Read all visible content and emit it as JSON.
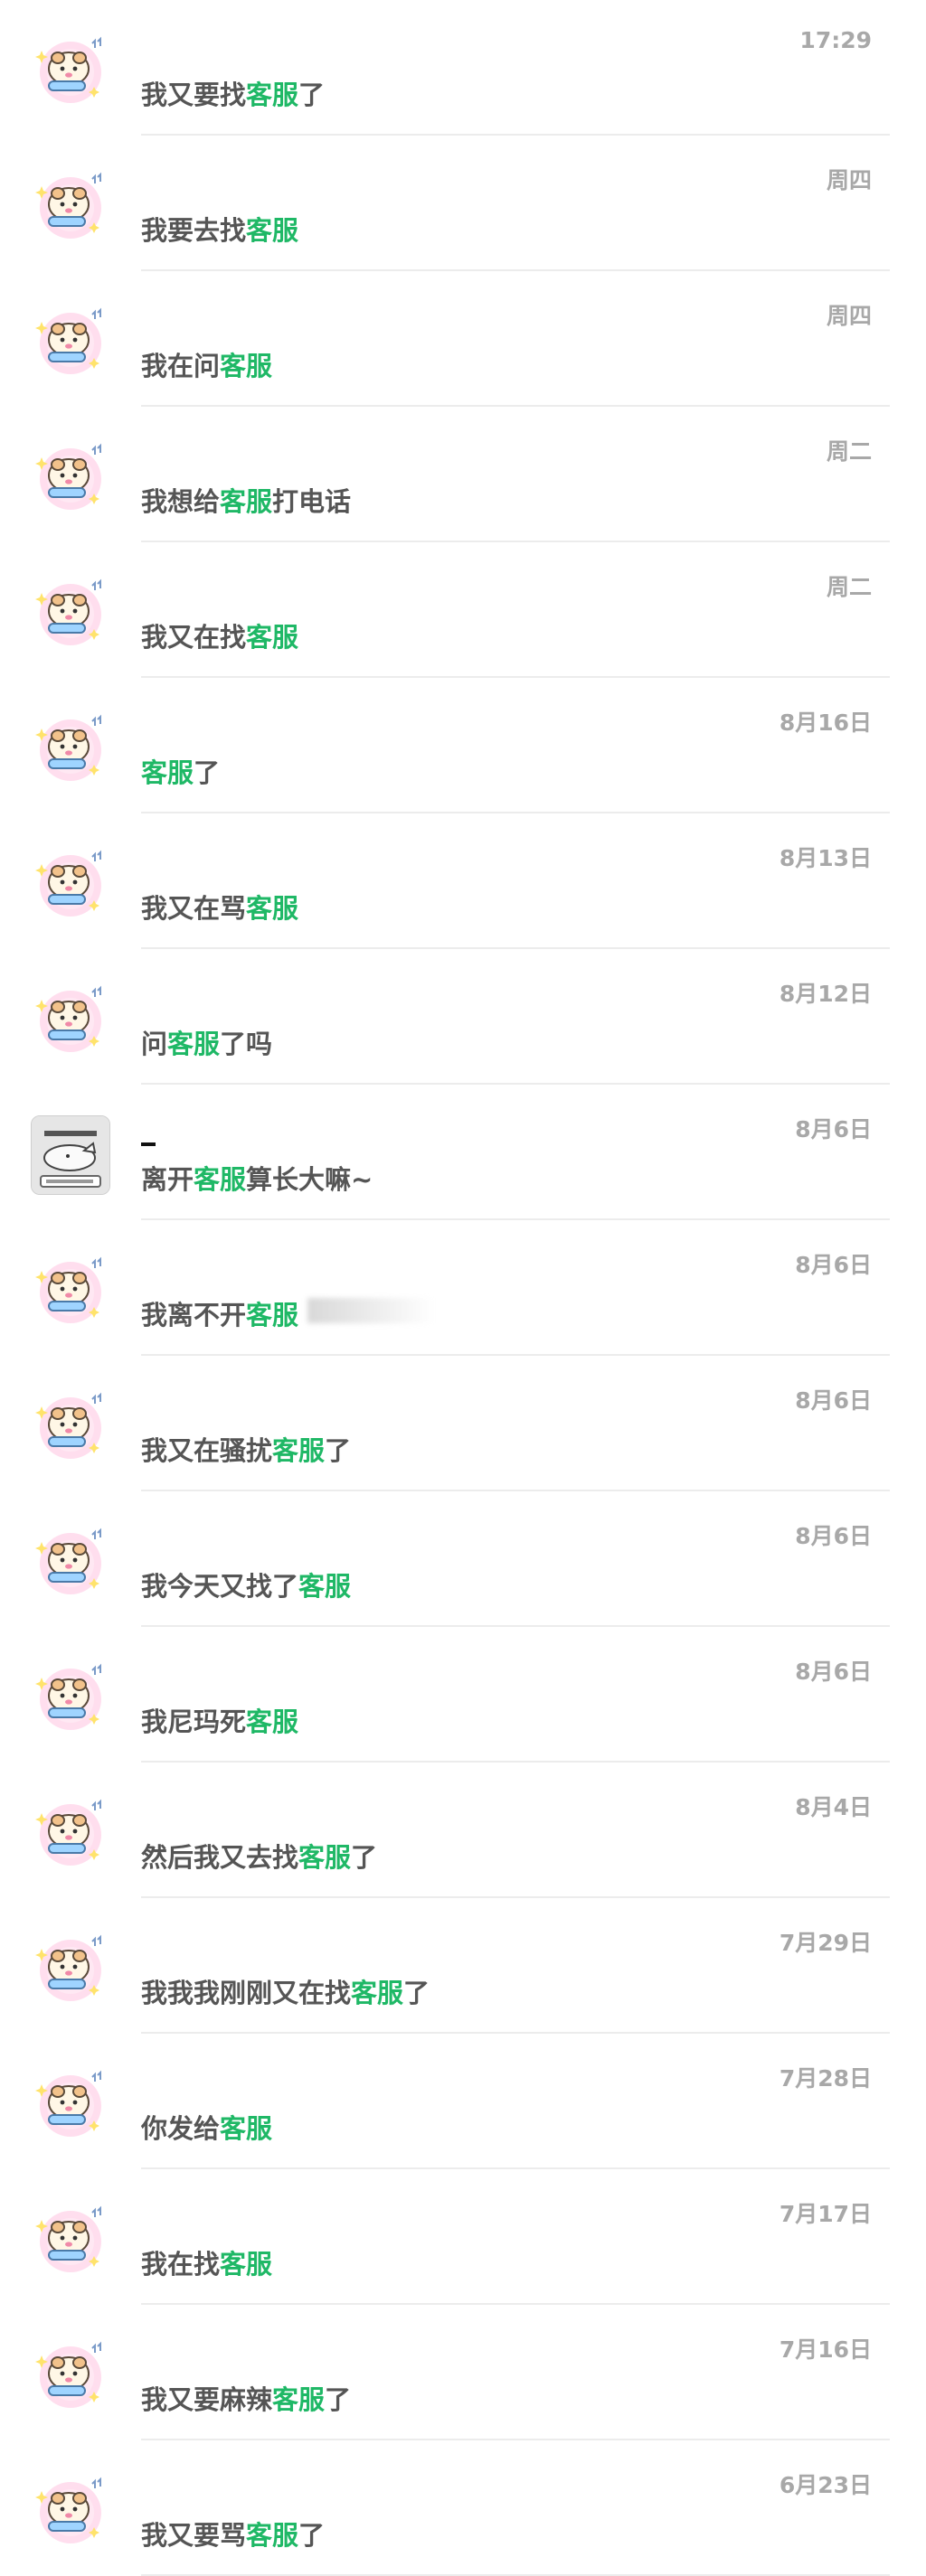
{
  "rows": [
    {
      "time": "17:29",
      "before": "我又要找",
      "keyword": "客服",
      "after": "了",
      "avatar": "hamster"
    },
    {
      "time": "周四",
      "before": "我要去找",
      "keyword": "客服",
      "after": "",
      "avatar": "hamster"
    },
    {
      "time": "周四",
      "before": "我在问",
      "keyword": "客服",
      "after": "",
      "avatar": "hamster"
    },
    {
      "time": "周二",
      "before": "我想给",
      "keyword": "客服",
      "after": "打电话",
      "avatar": "hamster"
    },
    {
      "time": "周二",
      "before": "我又在找",
      "keyword": "客服",
      "after": "",
      "avatar": "hamster"
    },
    {
      "time": "8月16日",
      "before": "",
      "keyword": "客服",
      "after": "了",
      "avatar": "hamster"
    },
    {
      "time": "8月13日",
      "before": "我又在骂",
      "keyword": "客服",
      "after": "",
      "avatar": "hamster"
    },
    {
      "time": "8月12日",
      "before": "问",
      "keyword": "客服",
      "after": "了吗",
      "avatar": "hamster"
    },
    {
      "time": "8月6日",
      "before": "离开",
      "keyword": "客服",
      "after": "算长大嘛~",
      "avatar": "cat"
    },
    {
      "time": "8月6日",
      "before": "我离不开",
      "keyword": "客服",
      "after": "",
      "avatar": "hamster"
    },
    {
      "time": "8月6日",
      "before": "我又在骚扰",
      "keyword": "客服",
      "after": "了",
      "avatar": "hamster"
    },
    {
      "time": "8月6日",
      "before": "我今天又找了",
      "keyword": "客服",
      "after": "",
      "avatar": "hamster"
    },
    {
      "time": "8月6日",
      "before": "我尼玛死",
      "keyword": "客服",
      "after": "",
      "avatar": "hamster"
    },
    {
      "time": "8月4日",
      "before": "然后我又去找",
      "keyword": "客服",
      "after": "了",
      "avatar": "hamster"
    },
    {
      "time": "7月29日",
      "before": "我我我刚刚又在找",
      "keyword": "客服",
      "after": "了",
      "avatar": "hamster"
    },
    {
      "time": "7月28日",
      "before": "你发给",
      "keyword": "客服",
      "after": "",
      "avatar": "hamster"
    },
    {
      "time": "7月17日",
      "before": "我在找",
      "keyword": "客服",
      "after": "",
      "avatar": "hamster"
    },
    {
      "time": "7月16日",
      "before": "我又要麻辣",
      "keyword": "客服",
      "after": "了",
      "avatar": "hamster"
    },
    {
      "time": "6月23日",
      "before": "我又要骂",
      "keyword": "客服",
      "after": "了",
      "avatar": "hamster"
    }
  ],
  "colors": {
    "keyword": "#1fb866",
    "text": "#555555",
    "time": "#a8a8a8",
    "divider": "#ececec"
  }
}
